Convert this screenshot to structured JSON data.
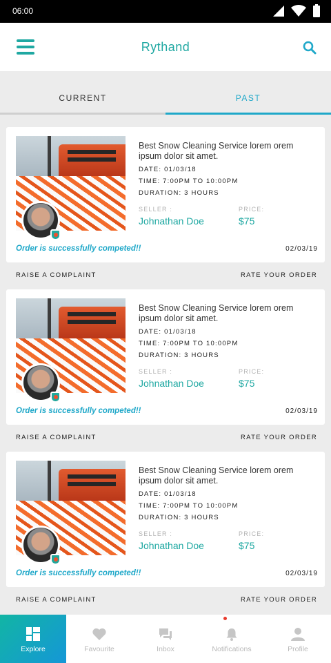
{
  "status_bar": {
    "time": "06:00"
  },
  "app_bar": {
    "title": "Rythand"
  },
  "tabs": [
    {
      "label": "CURRENT",
      "active": false
    },
    {
      "label": "PAST",
      "active": true
    }
  ],
  "orders": [
    {
      "service": "Best Snow Cleaning Service lorem orem ipsum dolor sit amet.",
      "date_line": "DATE: 01/03/18",
      "time_line": "TIME: 7:00PM TO 10:00PM",
      "duration_line": "DURATION: 3 HOURS",
      "seller_label": "SELLER :",
      "seller_name": "Johnathan Doe",
      "price_label": "PRICE:",
      "price": "$75",
      "status": "Order is successfully competed!!",
      "completed_date": "02/03/19",
      "complaint_label": "RAISE A COMPLAINT",
      "rate_label": "RATE YOUR ORDER"
    },
    {
      "service": "Best Snow Cleaning Service lorem orem ipsum dolor sit amet.",
      "date_line": "DATE: 01/03/18",
      "time_line": "TIME: 7:00PM TO 10:00PM",
      "duration_line": "DURATION: 3 HOURS",
      "seller_label": "SELLER :",
      "seller_name": "Johnathan Doe",
      "price_label": "PRICE:",
      "price": "$75",
      "status": "Order is successfully competed!!",
      "completed_date": "02/03/19",
      "complaint_label": "RAISE A COMPLAINT",
      "rate_label": "RATE YOUR ORDER"
    },
    {
      "service": "Best Snow Cleaning Service lorem orem ipsum dolor sit amet.",
      "date_line": "DATE: 01/03/18",
      "time_line": "TIME: 7:00PM TO 10:00PM",
      "duration_line": "DURATION: 3 HOURS",
      "seller_label": "SELLER :",
      "seller_name": "Johnathan Doe",
      "price_label": "PRICE:",
      "price": "$75",
      "status": "Order is successfully competed!!",
      "completed_date": "02/03/19",
      "complaint_label": "RAISE A COMPLAINT",
      "rate_label": "RATE YOUR ORDER"
    }
  ],
  "bottom_nav": [
    {
      "label": "Explore",
      "icon": "grid-icon",
      "active": true
    },
    {
      "label": "Favourite",
      "icon": "heart-icon",
      "active": false
    },
    {
      "label": "Inbox",
      "icon": "chat-icon",
      "active": false
    },
    {
      "label": "Notifications",
      "icon": "bell-icon",
      "active": false
    },
    {
      "label": "Profile",
      "icon": "user-icon",
      "active": false
    }
  ],
  "colors": {
    "accent": "#1fa8a2",
    "status_blue": "#1fa8c9",
    "nav_gradient_start": "#12b5a4",
    "nav_gradient_end": "#1597d7",
    "notification_dot": "#e83a2d"
  }
}
